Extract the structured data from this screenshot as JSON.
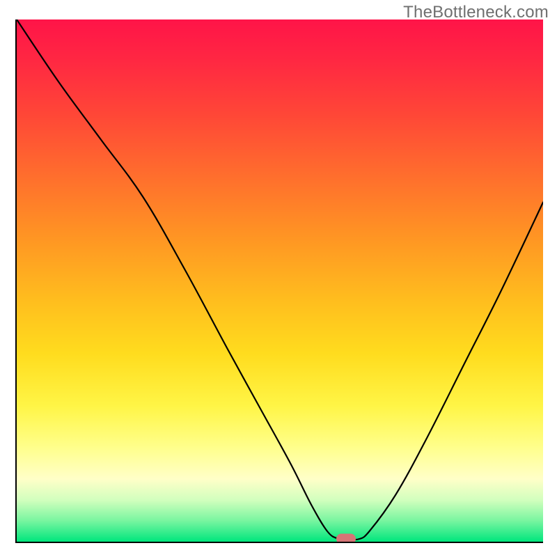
{
  "watermark": "TheBottleneck.com",
  "chart_data": {
    "type": "line",
    "title": "",
    "xlabel": "",
    "ylabel": "",
    "xlim": [
      0,
      100
    ],
    "ylim": [
      0,
      100
    ],
    "gradient_colors_top_to_bottom": [
      "#ff1448",
      "#ff6e2d",
      "#ffc81e",
      "#fff58c",
      "#00e67d"
    ],
    "curve": {
      "name": "bottleneck-curve",
      "x": [
        0,
        8,
        16,
        24,
        32,
        40,
        46,
        52,
        56,
        59,
        61,
        63,
        65,
        67,
        72,
        78,
        85,
        92,
        100
      ],
      "y": [
        100,
        88,
        77,
        66,
        52,
        37,
        26,
        15,
        7,
        2,
        0.6,
        0.5,
        0.5,
        2,
        9,
        20,
        34,
        48,
        65
      ]
    },
    "marker": {
      "x": 62.5,
      "y": 0.5,
      "color": "#d57576"
    },
    "axes": {
      "left": true,
      "bottom": true,
      "grid": false
    }
  }
}
